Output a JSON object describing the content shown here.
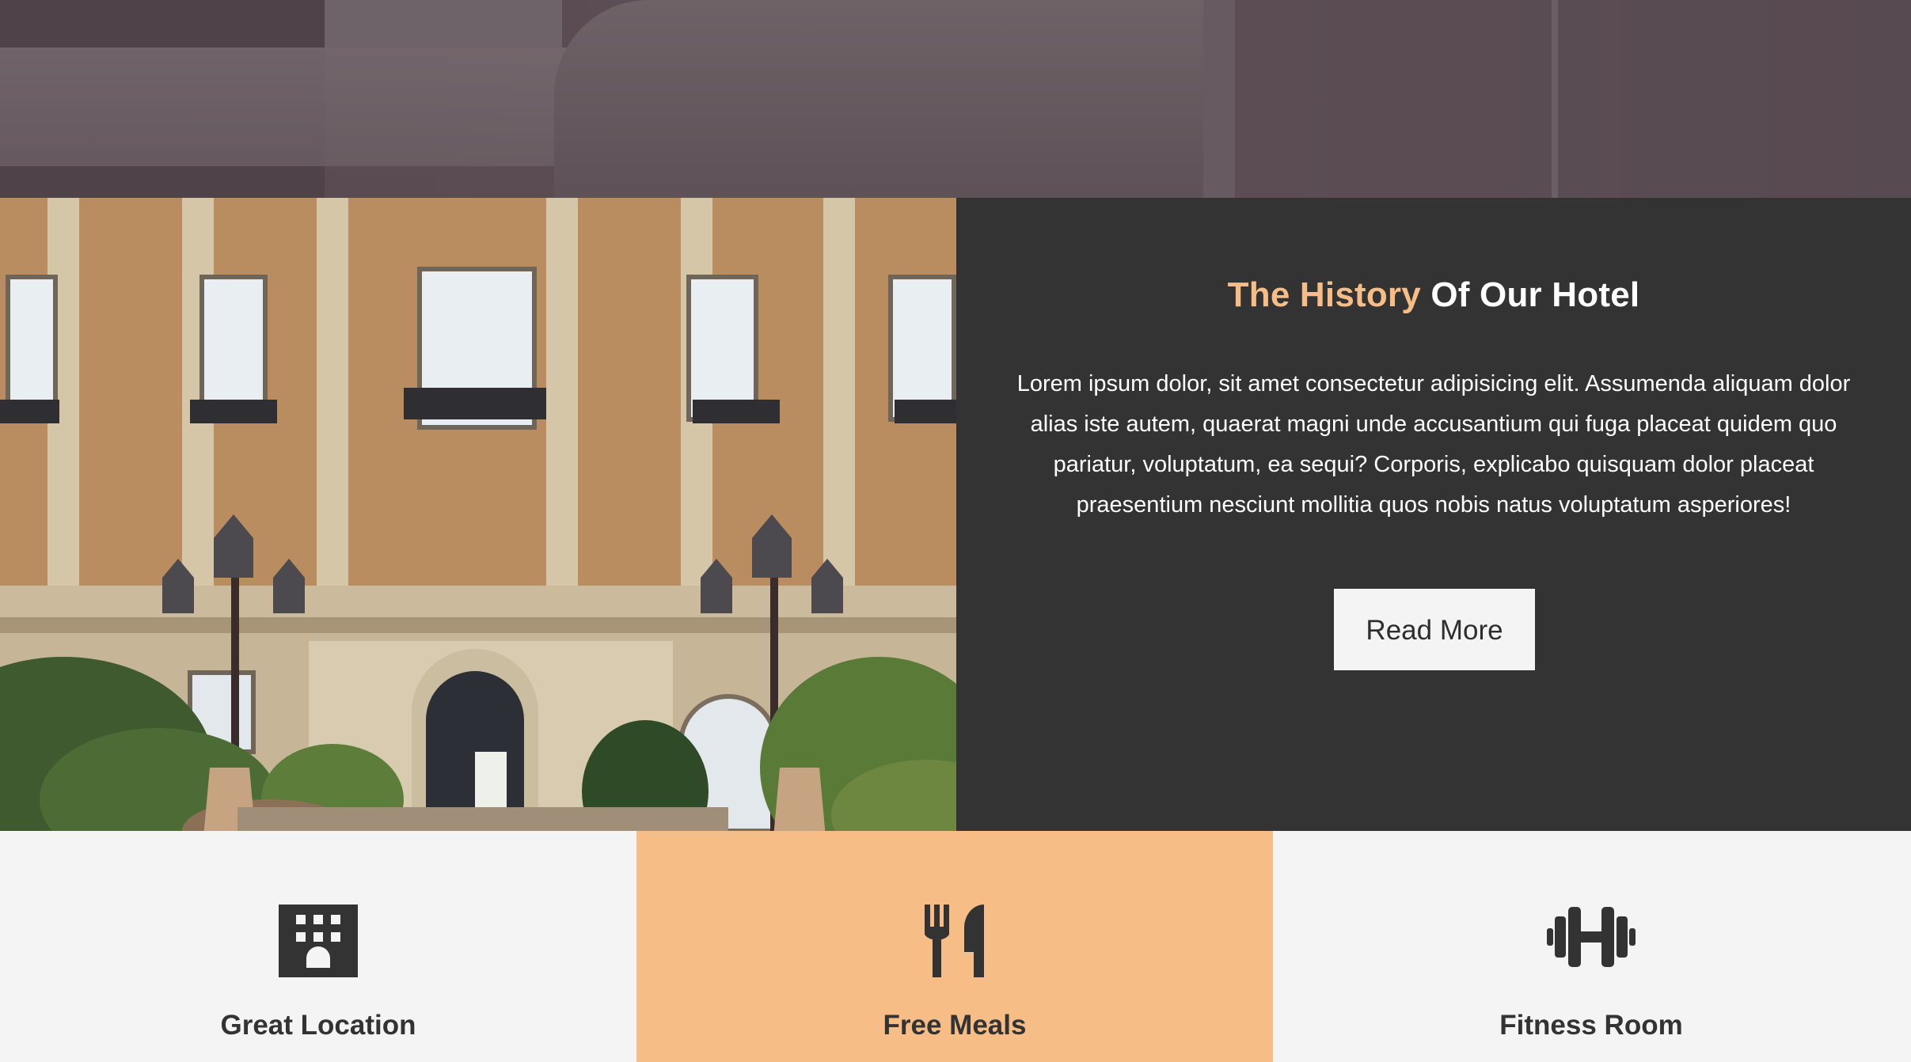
{
  "history": {
    "title_accent": "The History",
    "title_rest": "Of Our Hotel",
    "body": "Lorem ipsum dolor, sit amet consectetur adipisicing elit. Assumenda aliquam dolor alias iste autem, quaerat magni unde accusantium qui fuga placeat quidem quo pariatur, voluptatum, ea sequi? Corporis, explicabo quisquam dolor placeat praesentium nesciunt mollitia quos nobis natus voluptatum asperiores!",
    "button_label": "Read More"
  },
  "features": [
    {
      "label": "Great Location",
      "icon": "building-icon"
    },
    {
      "label": "Free Meals",
      "icon": "utensils-icon"
    },
    {
      "label": "Fitness Room",
      "icon": "dumbbell-icon"
    }
  ],
  "colors": {
    "accent": "#f6bd86",
    "panel": "#333333",
    "light": "#f4f4f4",
    "text_dark": "#333333"
  }
}
